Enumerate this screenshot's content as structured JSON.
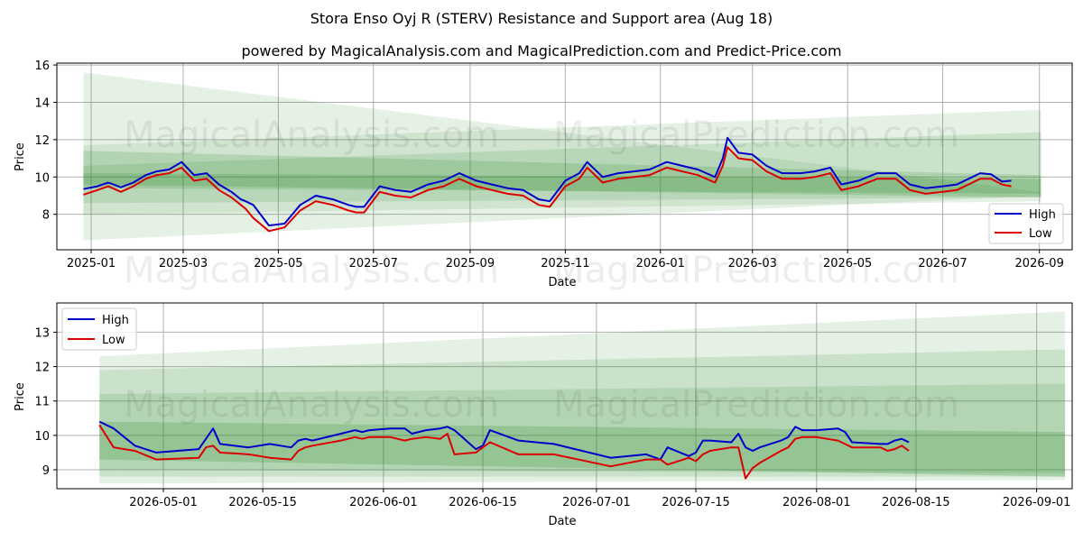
{
  "figure": {
    "title": "Stora Enso Oyj R (STERV) Resistance and Support area (Aug 18)",
    "subtitle": "powered by MagicalAnalysis.com and MagicalPrediction.com and Predict-Price.com",
    "watermark_left": "MagicalAnalysis.com",
    "watermark_right": "MagicalPrediction.com"
  },
  "colors": {
    "high": "#0000cc",
    "low": "#dd0000",
    "band": "#2e8b2e",
    "grid": "#b0b0b0"
  },
  "chart_data": [
    {
      "type": "line",
      "xlabel": "Date",
      "ylabel": "Price",
      "x_ticks": [
        "2025-01",
        "2025-03",
        "2025-05",
        "2025-07",
        "2025-09",
        "2025-11",
        "2026-01",
        "2026-03",
        "2026-05",
        "2026-07",
        "2026-09"
      ],
      "y_ticks": [
        "8",
        "10",
        "12",
        "14",
        "16"
      ],
      "xlim": [
        "2024-12-10",
        "2026-09-22"
      ],
      "ylim": [
        6.1,
        16.1
      ],
      "grid": true,
      "legend": "lower right",
      "bands": [
        {
          "start": "2024-12-27",
          "end": "2026-09-02",
          "upper": [
            15.6,
            9.2
          ],
          "lower": [
            6.6,
            9.0
          ],
          "opacity": 0.12
        },
        {
          "start": "2024-12-27",
          "end": "2026-09-02",
          "upper": [
            11.7,
            13.6
          ],
          "lower": [
            8.0,
            8.7
          ],
          "opacity": 0.12
        },
        {
          "start": "2024-12-27",
          "end": "2026-09-02",
          "upper": [
            10.6,
            12.4
          ],
          "lower": [
            8.6,
            8.9
          ],
          "opacity": 0.15
        },
        {
          "start": "2024-12-27",
          "end": "2026-09-02",
          "upper": [
            11.4,
            10.1
          ],
          "lower": [
            9.4,
            9.1
          ],
          "opacity": 0.18
        },
        {
          "start": "2024-12-27",
          "end": "2026-09-02",
          "upper": [
            10.2,
            9.9
          ],
          "lower": [
            9.6,
            8.9
          ],
          "opacity": 0.2
        }
      ],
      "series": [
        {
          "name": "High",
          "x": [
            "2024-12-27",
            "2025-01-05",
            "2025-01-12",
            "2025-01-20",
            "2025-01-28",
            "2025-02-05",
            "2025-02-12",
            "2025-02-20",
            "2025-02-28",
            "2025-03-08",
            "2025-03-16",
            "2025-03-24",
            "2025-04-01",
            "2025-04-07",
            "2025-04-10",
            "2025-04-15",
            "2025-04-25",
            "2025-05-05",
            "2025-05-15",
            "2025-05-25",
            "2025-06-05",
            "2025-06-15",
            "2025-06-20",
            "2025-06-25",
            "2025-07-05",
            "2025-07-15",
            "2025-07-25",
            "2025-08-05",
            "2025-08-15",
            "2025-08-25",
            "2025-09-05",
            "2025-09-15",
            "2025-09-25",
            "2025-10-05",
            "2025-10-15",
            "2025-10-22",
            "2025-11-01",
            "2025-11-10",
            "2025-11-15",
            "2025-11-25",
            "2025-12-05",
            "2025-12-15",
            "2025-12-25",
            "2026-01-05",
            "2026-01-15",
            "2026-01-25",
            "2026-02-05",
            "2026-02-10",
            "2026-02-13",
            "2026-02-20",
            "2026-03-01",
            "2026-03-10",
            "2026-03-20",
            "2026-04-01",
            "2026-04-10",
            "2026-04-20",
            "2026-04-27",
            "2026-05-08",
            "2026-05-20",
            "2026-06-01",
            "2026-06-10",
            "2026-06-20",
            "2026-07-01",
            "2026-07-10",
            "2026-07-20",
            "2026-07-25",
            "2026-08-01",
            "2026-08-08",
            "2026-08-14"
          ],
          "values": [
            9.35,
            9.5,
            9.7,
            9.45,
            9.7,
            10.1,
            10.3,
            10.4,
            10.8,
            10.1,
            10.2,
            9.6,
            9.2,
            8.8,
            8.7,
            8.5,
            7.4,
            7.5,
            8.5,
            9.0,
            8.8,
            8.5,
            8.4,
            8.4,
            9.5,
            9.3,
            9.2,
            9.6,
            9.8,
            10.2,
            9.8,
            9.6,
            9.4,
            9.3,
            8.8,
            8.7,
            9.8,
            10.2,
            10.8,
            10.0,
            10.2,
            10.3,
            10.4,
            10.8,
            10.6,
            10.4,
            10.0,
            11.0,
            12.1,
            11.3,
            11.2,
            10.6,
            10.2,
            10.2,
            10.3,
            10.5,
            9.6,
            9.8,
            10.2,
            10.2,
            9.6,
            9.4,
            9.5,
            9.6,
            10.0,
            10.2,
            10.15,
            9.75,
            9.8
          ]
        },
        {
          "name": "Low",
          "x": [
            "2024-12-27",
            "2025-01-05",
            "2025-01-12",
            "2025-01-20",
            "2025-01-28",
            "2025-02-05",
            "2025-02-12",
            "2025-02-20",
            "2025-02-28",
            "2025-03-08",
            "2025-03-16",
            "2025-03-24",
            "2025-04-01",
            "2025-04-07",
            "2025-04-10",
            "2025-04-15",
            "2025-04-25",
            "2025-05-05",
            "2025-05-15",
            "2025-05-25",
            "2025-06-05",
            "2025-06-15",
            "2025-06-20",
            "2025-06-25",
            "2025-07-05",
            "2025-07-15",
            "2025-07-25",
            "2025-08-05",
            "2025-08-15",
            "2025-08-25",
            "2025-09-05",
            "2025-09-15",
            "2025-09-25",
            "2025-10-05",
            "2025-10-15",
            "2025-10-22",
            "2025-11-01",
            "2025-11-10",
            "2025-11-15",
            "2025-11-25",
            "2025-12-05",
            "2025-12-15",
            "2025-12-25",
            "2026-01-05",
            "2026-01-15",
            "2026-01-25",
            "2026-02-05",
            "2026-02-10",
            "2026-02-13",
            "2026-02-20",
            "2026-03-01",
            "2026-03-10",
            "2026-03-20",
            "2026-04-01",
            "2026-04-10",
            "2026-04-20",
            "2026-04-27",
            "2026-05-08",
            "2026-05-20",
            "2026-06-01",
            "2026-06-10",
            "2026-06-20",
            "2026-07-01",
            "2026-07-10",
            "2026-07-20",
            "2026-07-25",
            "2026-08-01",
            "2026-08-08",
            "2026-08-14"
          ],
          "values": [
            9.05,
            9.3,
            9.5,
            9.2,
            9.5,
            9.9,
            10.1,
            10.2,
            10.5,
            9.8,
            9.9,
            9.3,
            8.9,
            8.5,
            8.3,
            7.8,
            7.1,
            7.3,
            8.2,
            8.7,
            8.5,
            8.2,
            8.1,
            8.1,
            9.2,
            9.0,
            8.9,
            9.3,
            9.5,
            9.9,
            9.5,
            9.3,
            9.1,
            9.0,
            8.5,
            8.4,
            9.5,
            9.9,
            10.5,
            9.7,
            9.9,
            10.0,
            10.1,
            10.5,
            10.3,
            10.1,
            9.7,
            10.6,
            11.6,
            11.0,
            10.9,
            10.3,
            9.9,
            9.9,
            10.0,
            10.2,
            9.3,
            9.5,
            9.9,
            9.9,
            9.3,
            9.1,
            9.2,
            9.3,
            9.7,
            9.9,
            9.9,
            9.6,
            9.5
          ]
        }
      ]
    },
    {
      "type": "line",
      "xlabel": "Date",
      "ylabel": "Price",
      "x_ticks": [
        "2026-05-01",
        "2026-05-15",
        "2026-06-01",
        "2026-06-15",
        "2026-07-01",
        "2026-07-15",
        "2026-08-01",
        "2026-08-15",
        "2026-09-01"
      ],
      "y_ticks": [
        "9",
        "10",
        "11",
        "12",
        "13"
      ],
      "xlim": [
        "2026-04-16",
        "2026-09-06"
      ],
      "ylim": [
        8.45,
        13.85
      ],
      "grid": true,
      "legend": "upper left",
      "bands": [
        {
          "start": "2026-04-22",
          "end": "2026-09-05",
          "upper": [
            12.3,
            13.6
          ],
          "lower": [
            8.6,
            8.7
          ],
          "opacity": 0.12
        },
        {
          "start": "2026-04-22",
          "end": "2026-09-05",
          "upper": [
            11.9,
            12.5
          ],
          "lower": [
            8.8,
            8.8
          ],
          "opacity": 0.15
        },
        {
          "start": "2026-04-22",
          "end": "2026-09-05",
          "upper": [
            11.2,
            11.5
          ],
          "lower": [
            9.0,
            8.9
          ],
          "opacity": 0.15
        },
        {
          "start": "2026-04-22",
          "end": "2026-09-05",
          "upper": [
            10.4,
            10.1
          ],
          "lower": [
            9.3,
            8.8
          ],
          "opacity": 0.22
        }
      ],
      "series": [
        {
          "name": "High",
          "x": [
            "2026-04-22",
            "2026-04-24",
            "2026-04-27",
            "2026-04-30",
            "2026-05-06",
            "2026-05-07",
            "2026-05-08",
            "2026-05-09",
            "2026-05-13",
            "2026-05-16",
            "2026-05-19",
            "2026-05-20",
            "2026-05-21",
            "2026-05-22",
            "2026-05-26",
            "2026-05-28",
            "2026-05-29",
            "2026-05-30",
            "2026-06-02",
            "2026-06-04",
            "2026-06-05",
            "2026-06-07",
            "2026-06-09",
            "2026-06-10",
            "2026-06-11",
            "2026-06-14",
            "2026-06-15",
            "2026-06-16",
            "2026-06-20",
            "2026-06-25",
            "2026-07-03",
            "2026-07-08",
            "2026-07-10",
            "2026-07-11",
            "2026-07-14",
            "2026-07-15",
            "2026-07-16",
            "2026-07-17",
            "2026-07-20",
            "2026-07-21",
            "2026-07-22",
            "2026-07-23",
            "2026-07-24",
            "2026-07-27",
            "2026-07-28",
            "2026-07-29",
            "2026-07-30",
            "2026-07-31",
            "2026-08-01",
            "2026-08-04",
            "2026-08-05",
            "2026-08-06",
            "2026-08-10",
            "2026-08-11",
            "2026-08-12",
            "2026-08-13",
            "2026-08-14"
          ],
          "values": [
            10.4,
            10.2,
            9.7,
            9.5,
            9.6,
            9.9,
            10.2,
            9.75,
            9.65,
            9.75,
            9.65,
            9.85,
            9.9,
            9.85,
            10.05,
            10.15,
            10.1,
            10.15,
            10.2,
            10.2,
            10.05,
            10.15,
            10.2,
            10.25,
            10.15,
            9.6,
            9.7,
            10.15,
            9.85,
            9.75,
            9.35,
            9.45,
            9.3,
            9.65,
            9.4,
            9.5,
            9.85,
            9.85,
            9.8,
            10.05,
            9.65,
            9.55,
            9.65,
            9.85,
            9.95,
            10.25,
            10.15,
            10.15,
            10.15,
            10.2,
            10.1,
            9.8,
            9.75,
            9.75,
            9.85,
            9.9,
            9.8
          ]
        },
        {
          "name": "Low",
          "x": [
            "2026-04-22",
            "2026-04-24",
            "2026-04-27",
            "2026-04-30",
            "2026-05-06",
            "2026-05-07",
            "2026-05-08",
            "2026-05-09",
            "2026-05-13",
            "2026-05-16",
            "2026-05-19",
            "2026-05-20",
            "2026-05-21",
            "2026-05-22",
            "2026-05-26",
            "2026-05-28",
            "2026-05-29",
            "2026-05-30",
            "2026-06-02",
            "2026-06-04",
            "2026-06-05",
            "2026-06-07",
            "2026-06-09",
            "2026-06-10",
            "2026-06-11",
            "2026-06-14",
            "2026-06-15",
            "2026-06-16",
            "2026-06-20",
            "2026-06-25",
            "2026-07-03",
            "2026-07-08",
            "2026-07-10",
            "2026-07-11",
            "2026-07-14",
            "2026-07-15",
            "2026-07-16",
            "2026-07-17",
            "2026-07-20",
            "2026-07-21",
            "2026-07-22",
            "2026-07-23",
            "2026-07-24",
            "2026-07-27",
            "2026-07-28",
            "2026-07-29",
            "2026-07-30",
            "2026-07-31",
            "2026-08-01",
            "2026-08-04",
            "2026-08-05",
            "2026-08-06",
            "2026-08-10",
            "2026-08-11",
            "2026-08-12",
            "2026-08-13",
            "2026-08-14"
          ],
          "values": [
            10.3,
            9.65,
            9.55,
            9.3,
            9.35,
            9.65,
            9.7,
            9.5,
            9.45,
            9.35,
            9.3,
            9.55,
            9.65,
            9.7,
            9.85,
            9.95,
            9.9,
            9.95,
            9.95,
            9.85,
            9.9,
            9.95,
            9.9,
            10.05,
            9.45,
            9.5,
            9.65,
            9.8,
            9.45,
            9.45,
            9.1,
            9.3,
            9.3,
            9.15,
            9.35,
            9.25,
            9.45,
            9.55,
            9.65,
            9.65,
            8.75,
            9.05,
            9.2,
            9.55,
            9.65,
            9.9,
            9.95,
            9.95,
            9.95,
            9.85,
            9.75,
            9.65,
            9.65,
            9.55,
            9.6,
            9.7,
            9.55
          ]
        }
      ]
    }
  ]
}
